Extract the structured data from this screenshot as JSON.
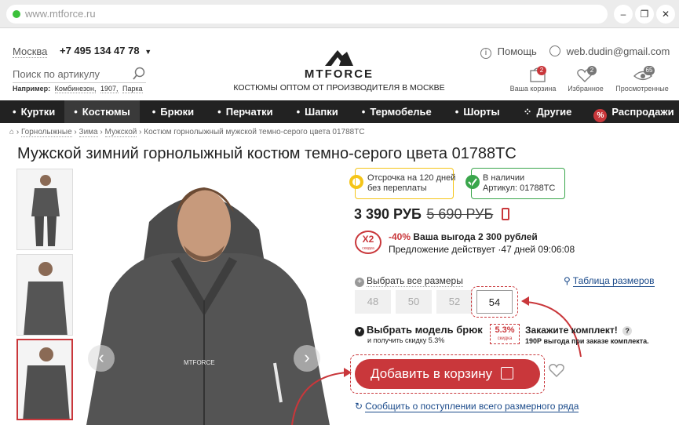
{
  "browser": {
    "url": "www.mtforce.ru"
  },
  "header": {
    "city": "Москва",
    "phone": "+7 495 134 47 78",
    "search_placeholder": "Поиск по артикулу",
    "example_label": "Например:",
    "examples": [
      "Комбинезон,",
      "1907,",
      "Парка"
    ],
    "logo_text": "MTFORCE",
    "tagline": "КОСТЮМЫ ОПТОМ ОТ ПРОИЗВОДИТЕЛЯ В МОСКВЕ",
    "help": "Помощь",
    "user": "web.dudin@gmail.com",
    "cart": {
      "label": "Ваша корзина",
      "count": "2"
    },
    "favorites": {
      "label": "Избранное",
      "count": "2"
    },
    "viewed": {
      "label": "Просмотренные",
      "count": "65"
    }
  },
  "nav": {
    "items": [
      "Куртки",
      "Костюмы",
      "Брюки",
      "Перчатки",
      "Шапки",
      "Термобелье",
      "Шорты",
      "Другие",
      "Распродажи"
    ]
  },
  "breadcrumbs": [
    "Горнолыжные",
    "Зима",
    "Мужской",
    "Костюм горнолыжный мужской темно-серого цвета 01788TC"
  ],
  "product": {
    "title": "Мужской зимний горнолыжный костюм темно-серого цвета 01788TC",
    "installment": "Отсрочка на 120 дней без переплаты",
    "installment_l1": "Отсрочка на 120 дней",
    "installment_l2": "без переплаты",
    "stock_l1": "В наличии",
    "stock_l2": "Артикул: 01788TC",
    "price": "3 390 РУБ",
    "old_price": "5 690 РУБ",
    "x2_badge": "X2",
    "x2_sub": "скидка",
    "discount": "-40%",
    "benefit": "Ваша выгода 2 300 рублей",
    "offer": "Предложение действует",
    "offer_time": "·47 дней  09:06:08",
    "select_all_sizes": "Выбрать все размеры",
    "size_table": "Таблица размеров",
    "sizes": [
      "48",
      "50",
      "52",
      "54"
    ],
    "selected_size": "54",
    "pants_title": "Выбрать модель брюк",
    "pants_sub": "и получить скидку 5.3%",
    "discount_badge": "5.3%",
    "discount_badge_sub": "скидка",
    "order_title": "Закажите комплект!",
    "order_sub": "190Р выгода при заказе комплекта.",
    "add_to_cart": "Добавить в корзину",
    "notify": "Сообщить о поступлении всего размерного ряда",
    "jacket_logo": "MTFORCE"
  },
  "colors": {
    "accent": "#c9373b",
    "nav_bg": "#222222",
    "link": "#1a4a8a",
    "yellow_badge": "#f5c518",
    "green_badge": "#3aa64c"
  },
  "icons": [
    "location-icon",
    "chevron-down-icon",
    "search-icon",
    "help-icon",
    "user-icon",
    "cart-icon",
    "heart-icon",
    "eye-icon",
    "phone-icon",
    "plus-circle-icon",
    "hanger-icon",
    "check-circle-icon",
    "refresh-icon",
    "bag-icon",
    "arrow-left-icon",
    "arrow-right-icon"
  ]
}
